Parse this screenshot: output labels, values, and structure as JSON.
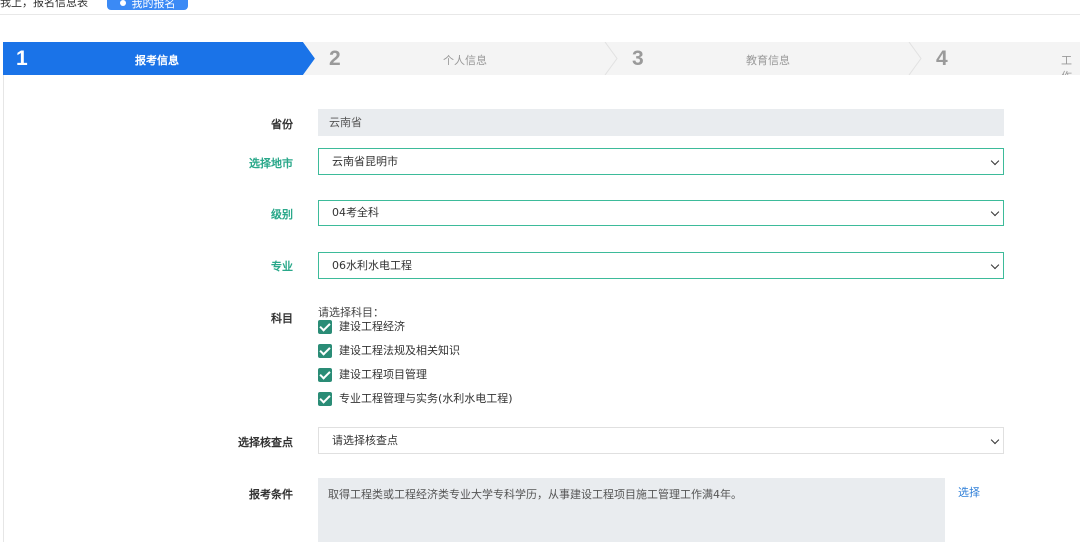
{
  "topbar": {
    "breadcrumb": "我上，报名信息表",
    "button_label": "我的报名"
  },
  "steps": [
    {
      "num": "1",
      "label": "报考信息",
      "active": true
    },
    {
      "num": "2",
      "label": "个人信息",
      "active": false
    },
    {
      "num": "3",
      "label": "教育信息",
      "active": false
    },
    {
      "num": "4",
      "label": "工作",
      "active": false
    }
  ],
  "form": {
    "province": {
      "label": "省份",
      "value": "云南省"
    },
    "city": {
      "label": "选择地市",
      "value": "云南省昆明市"
    },
    "level": {
      "label": "级别",
      "value": "04考全科"
    },
    "major": {
      "label": "专业",
      "value": "06水利水电工程"
    },
    "subjects": {
      "label": "科目",
      "prompt": "请选择科目：",
      "items": [
        {
          "label": "建设工程经济",
          "checked": true
        },
        {
          "label": "建设工程法规及相关知识",
          "checked": true
        },
        {
          "label": "建设工程项目管理",
          "checked": true
        },
        {
          "label": "专业工程管理与实务(水利水电工程)",
          "checked": true
        }
      ]
    },
    "checkpoint": {
      "label": "选择核查点",
      "placeholder": "请选择核查点"
    },
    "conditions": {
      "label": "报考条件",
      "value": "取得工程类或工程经济类专业大学专科学历，从事建设工程项目施工管理工作满4年。",
      "action": "选择"
    }
  },
  "colors": {
    "step_active": "#1a73e8",
    "step_inactive": "#f4f4f4",
    "accent_green": "#2aa88a",
    "checkbox": "#2a8c76",
    "link": "#2f7fd8"
  }
}
